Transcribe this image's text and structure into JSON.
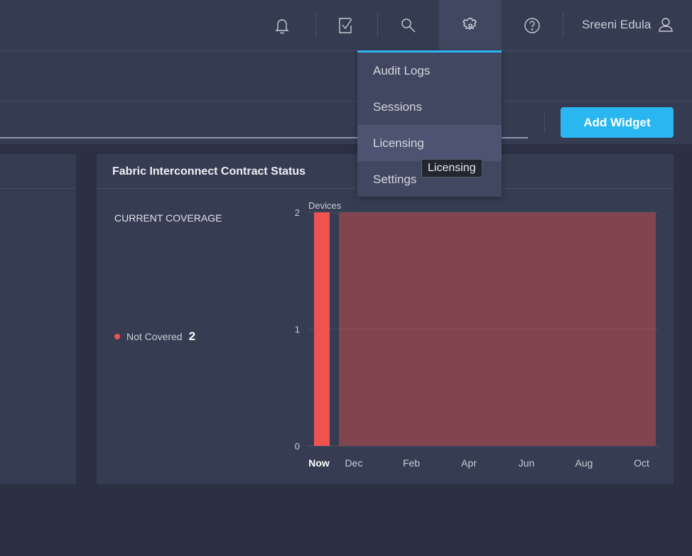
{
  "header": {
    "user_name": "Sreeni Edula",
    "icons": [
      "bell-icon",
      "task-check-icon",
      "search-icon",
      "gear-icon",
      "help-icon",
      "user-icon"
    ]
  },
  "toolbar": {
    "add_widget_label": "Add Widget"
  },
  "settings_menu": {
    "items": [
      {
        "label": "Audit Logs"
      },
      {
        "label": "Sessions"
      },
      {
        "label": "Licensing"
      },
      {
        "label": "Settings"
      }
    ],
    "hovered": "Licensing",
    "tooltip": "Licensing"
  },
  "widget": {
    "title": "Fabric Interconnect Contract Status",
    "coverage_label": "CURRENT COVERAGE",
    "legend": [
      {
        "label": "Not Covered",
        "value": "2",
        "color": "#ef5350"
      }
    ]
  },
  "chart_data": {
    "type": "bar",
    "ylabel": "Devices",
    "ylim": [
      0,
      2
    ],
    "yticks": [
      "0",
      "1",
      "2"
    ],
    "xticks": [
      "Now",
      "Dec",
      "Feb",
      "Apr",
      "Jun",
      "Aug",
      "Oct"
    ],
    "series": [
      {
        "name": "Not Covered",
        "now_value": 2,
        "forecast_value": 2,
        "color": "#ef5350",
        "forecast_color": "#81454f"
      }
    ],
    "grid": true
  }
}
